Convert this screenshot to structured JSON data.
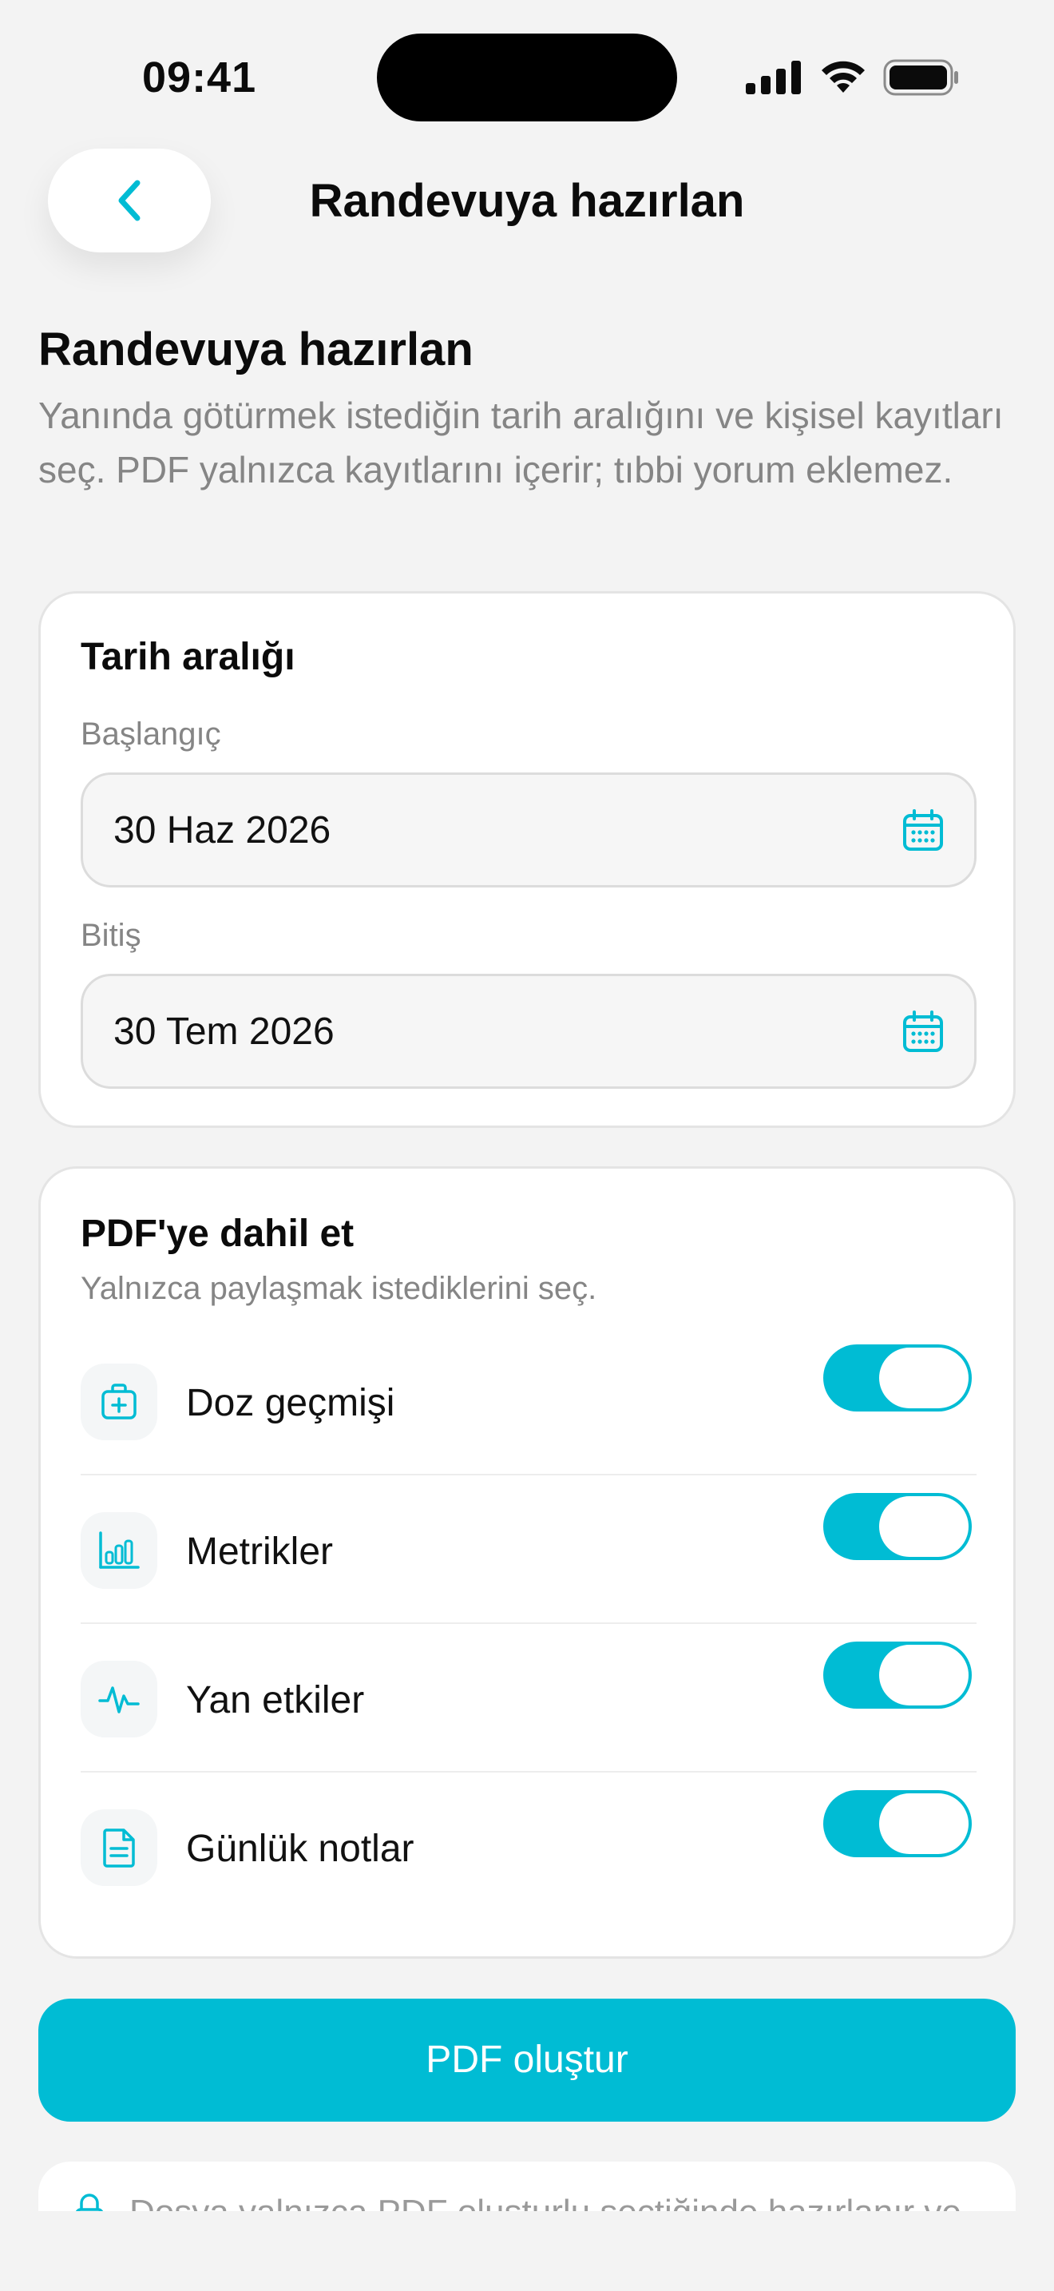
{
  "status_bar": {
    "time": "09:41"
  },
  "nav": {
    "title": "Randevuya hazırlan"
  },
  "header": {
    "title": "Randevuya hazırlan",
    "description": "Yanında götürmek istediğin tarih aralığını ve kişisel kayıtları seç. PDF yalnızca kayıtlarını içerir; tıbbi yorum eklemez."
  },
  "date_range": {
    "title": "Tarih aralığı",
    "start_label": "Başlangıç",
    "start_value": "30 Haz 2026",
    "end_label": "Bitiş",
    "end_value": "30 Tem 2026"
  },
  "pdf_options": {
    "title": "PDF'ye dahil et",
    "subtitle": "Yalnızca paylaşmak istediklerini seç.",
    "items": [
      {
        "label": "Doz geçmişi",
        "icon": "medkit-icon",
        "enabled": true
      },
      {
        "label": "Metrikler",
        "icon": "bar-chart-icon",
        "enabled": true
      },
      {
        "label": "Yan etkiler",
        "icon": "pulse-icon",
        "enabled": true
      },
      {
        "label": "Günlük notlar",
        "icon": "document-icon",
        "enabled": true
      }
    ]
  },
  "actions": {
    "primary_label": "PDF oluştur"
  },
  "notice": {
    "text": "Dosya yalnızca PDF oluşturlu seçtiğinde hazırlanır ve"
  },
  "colors": {
    "accent": "#00BCD4",
    "background": "#F3F3F3",
    "muted_text": "#858585"
  }
}
